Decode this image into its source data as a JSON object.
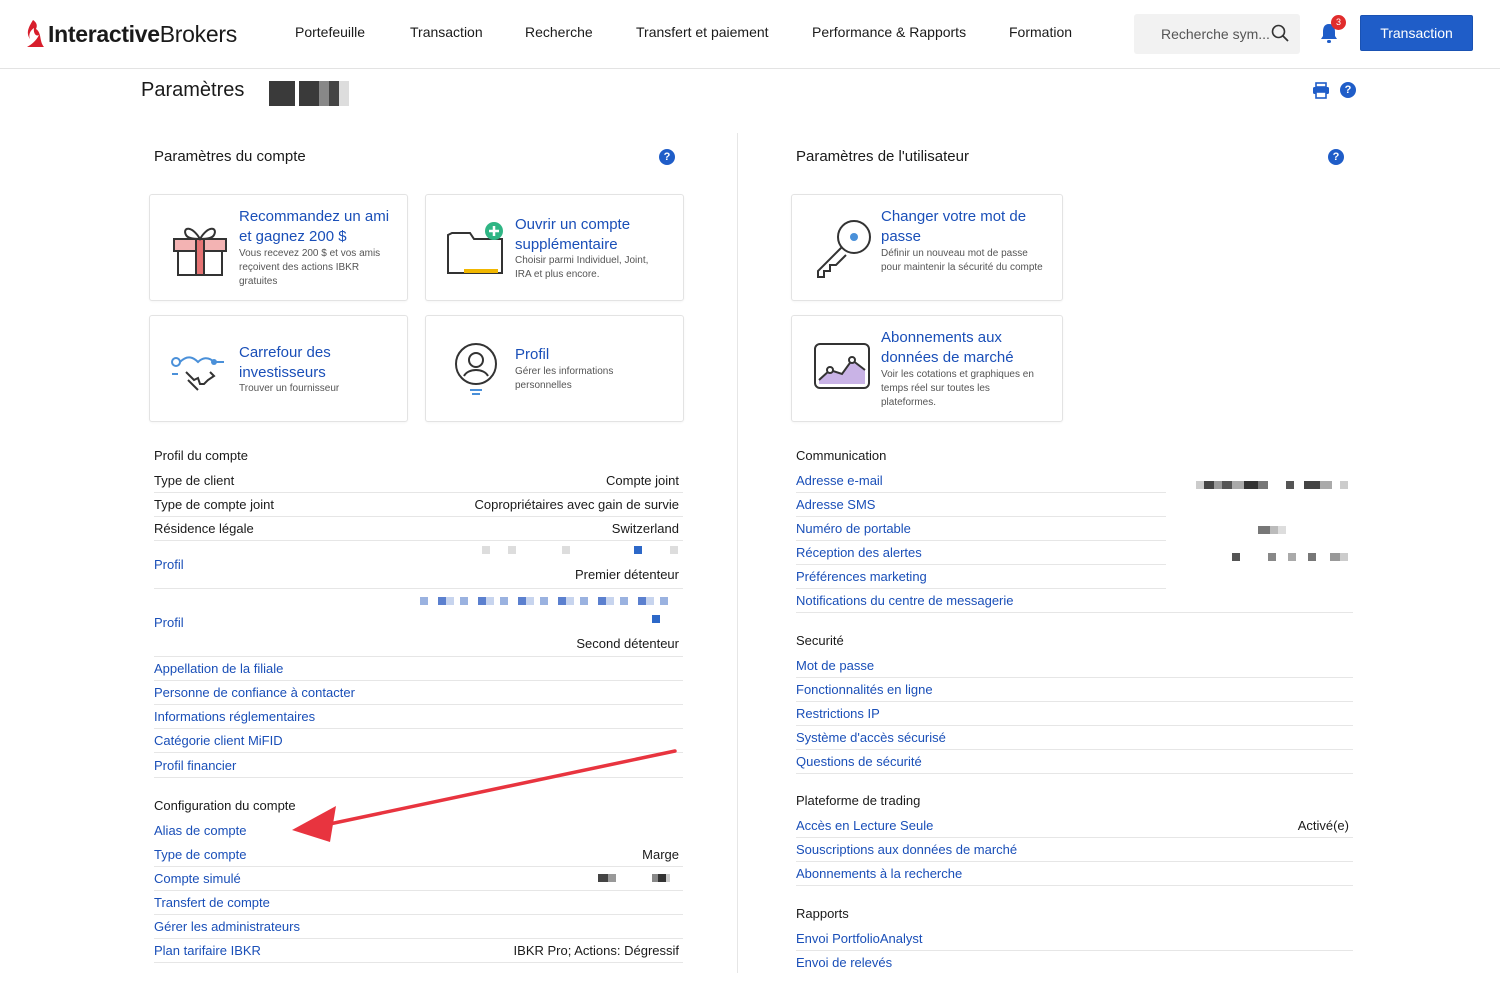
{
  "header": {
    "logo_bold": "Interactive",
    "logo_light": "Brokers",
    "nav": [
      "Portefeuille",
      "Transaction",
      "Recherche",
      "Transfert et paiement",
      "Performance & Rapports",
      "Formation"
    ],
    "search_placeholder": "Recherche sym...",
    "notif_count": "3",
    "transaction_button": "Transaction"
  },
  "page": {
    "title": "Paramètres"
  },
  "account_settings": {
    "title": "Paramètres du compte",
    "cards": [
      {
        "title": "Recommandez un ami et gagnez 200 $",
        "desc": "Vous recevez 200 $ et vos amis reçoivent des actions IBKR gratuites",
        "icon": "gift-icon"
      },
      {
        "title": "Ouvrir un compte supplémentaire",
        "desc": "Choisir parmi Individuel, Joint, IRA et plus encore.",
        "icon": "folder-add-icon"
      },
      {
        "title": "Carrefour des investisseurs",
        "desc": "Trouver un fournisseur",
        "icon": "handshake-icon"
      },
      {
        "title": "Profil",
        "desc": "Gérer les informations personnelles",
        "icon": "user-profile-icon"
      }
    ],
    "profile_section": {
      "title": "Profil du compte",
      "rows": [
        {
          "key": "Type de client",
          "value": "Compte joint"
        },
        {
          "key": "Type de compte joint",
          "value": "Copropriétaires avec gain de survie"
        },
        {
          "key": "Résidence légale",
          "value": "Switzerland"
        },
        {
          "key": "Profil",
          "value": "Premier détenteur"
        },
        {
          "key": "Profil",
          "value": "Second détenteur"
        }
      ],
      "links": [
        "Appellation de la filiale",
        "Personne de confiance à contacter",
        "Informations réglementaires",
        "Catégorie client MiFID",
        "Profil financier"
      ]
    },
    "config_section": {
      "title": "Configuration du compte",
      "rows": [
        {
          "key": "Alias de compte",
          "value": ""
        },
        {
          "key": "Type de compte",
          "value": "Marge"
        },
        {
          "key": "Compte simulé",
          "value": ""
        },
        {
          "key": "Transfert de compte",
          "value": ""
        },
        {
          "key": "Gérer les administrateurs",
          "value": ""
        },
        {
          "key": "Plan tarifaire IBKR",
          "value": "IBKR Pro; Actions: Dégressif"
        }
      ]
    }
  },
  "user_settings": {
    "title": "Paramètres de l'utilisateur",
    "cards": [
      {
        "title": "Changer votre mot de passe",
        "desc": "Définir un nouveau mot de passe pour maintenir la sécurité du compte",
        "icon": "key-icon"
      },
      {
        "title": "Abonnements aux données de marché",
        "desc": "Voir les cotations et graphiques en temps réel sur toutes les plateformes.",
        "icon": "market-chart-icon"
      }
    ],
    "communication": {
      "title": "Communication",
      "links": [
        "Adresse e-mail",
        "Adresse SMS",
        "Numéro de portable",
        "Réception des alertes",
        "Préférences marketing",
        "Notifications du centre de messagerie"
      ]
    },
    "security": {
      "title": "Securité",
      "links": [
        "Mot de passe",
        "Fonctionnalités en ligne",
        "Restrictions IP",
        "Système d'accès sécurisé",
        "Questions de sécurité"
      ]
    },
    "trading": {
      "title": "Plateforme de trading",
      "rows": [
        {
          "key": "Accès en Lecture Seule",
          "value": "Activé(e)"
        },
        {
          "key": "Souscriptions aux données de marché",
          "value": ""
        },
        {
          "key": "Abonnements à la recherche",
          "value": ""
        }
      ]
    },
    "reports": {
      "title": "Rapports",
      "links": [
        "Envoi PortfolioAnalyst",
        "Envoi de relevés"
      ]
    }
  },
  "colors": {
    "accent": "#1f5dc8",
    "link": "#1a4fb8",
    "brand_red": "#d81e2c",
    "arrow_red": "#e8343f"
  }
}
